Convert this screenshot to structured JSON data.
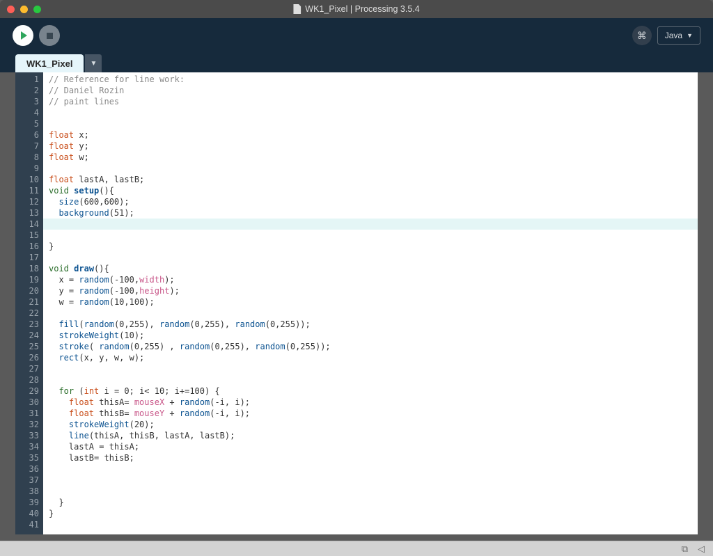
{
  "window": {
    "title": "WK1_Pixel | Processing 3.5.4"
  },
  "toolbar": {
    "mode": "Java"
  },
  "tabs": {
    "active": "WK1_Pixel"
  },
  "editor": {
    "line_count": 41,
    "highlighted_line": 14,
    "lines": [
      [
        [
          "comment",
          "// Reference for line work:"
        ]
      ],
      [
        [
          "comment",
          "// Daniel Rozin"
        ]
      ],
      [
        [
          "comment",
          "// paint lines"
        ]
      ],
      [],
      [],
      [
        [
          "type",
          "float"
        ],
        [
          "default",
          " x;"
        ]
      ],
      [
        [
          "type",
          "float"
        ],
        [
          "default",
          " y;"
        ]
      ],
      [
        [
          "type",
          "float"
        ],
        [
          "default",
          " w;"
        ]
      ],
      [],
      [
        [
          "type",
          "float"
        ],
        [
          "default",
          " lastA, lastB;"
        ]
      ],
      [
        [
          "keyword",
          "void"
        ],
        [
          "default",
          " "
        ],
        [
          "funcname",
          "setup"
        ],
        [
          "default",
          "(){"
        ]
      ],
      [
        [
          "default",
          "  "
        ],
        [
          "builtin",
          "size"
        ],
        [
          "default",
          "(600,600);"
        ]
      ],
      [
        [
          "default",
          "  "
        ],
        [
          "builtin",
          "background"
        ],
        [
          "default",
          "(51);"
        ]
      ],
      [],
      [],
      [
        [
          "default",
          "}"
        ]
      ],
      [],
      [
        [
          "keyword",
          "void"
        ],
        [
          "default",
          " "
        ],
        [
          "funcname",
          "draw"
        ],
        [
          "default",
          "(){"
        ]
      ],
      [
        [
          "default",
          "  x = "
        ],
        [
          "builtin",
          "random"
        ],
        [
          "default",
          "(-100,"
        ],
        [
          "special",
          "width"
        ],
        [
          "default",
          ");"
        ]
      ],
      [
        [
          "default",
          "  y = "
        ],
        [
          "builtin",
          "random"
        ],
        [
          "default",
          "(-100,"
        ],
        [
          "special",
          "height"
        ],
        [
          "default",
          ");"
        ]
      ],
      [
        [
          "default",
          "  w = "
        ],
        [
          "builtin",
          "random"
        ],
        [
          "default",
          "(10,100);"
        ]
      ],
      [],
      [
        [
          "default",
          "  "
        ],
        [
          "builtin",
          "fill"
        ],
        [
          "default",
          "("
        ],
        [
          "builtin",
          "random"
        ],
        [
          "default",
          "(0,255), "
        ],
        [
          "builtin",
          "random"
        ],
        [
          "default",
          "(0,255), "
        ],
        [
          "builtin",
          "random"
        ],
        [
          "default",
          "(0,255));"
        ]
      ],
      [
        [
          "default",
          "  "
        ],
        [
          "builtin",
          "strokeWeight"
        ],
        [
          "default",
          "(10);"
        ]
      ],
      [
        [
          "default",
          "  "
        ],
        [
          "builtin",
          "stroke"
        ],
        [
          "default",
          "( "
        ],
        [
          "builtin",
          "random"
        ],
        [
          "default",
          "(0,255) , "
        ],
        [
          "builtin",
          "random"
        ],
        [
          "default",
          "(0,255), "
        ],
        [
          "builtin",
          "random"
        ],
        [
          "default",
          "(0,255));"
        ]
      ],
      [
        [
          "default",
          "  "
        ],
        [
          "builtin",
          "rect"
        ],
        [
          "default",
          "(x, y, w, w);"
        ]
      ],
      [],
      [],
      [
        [
          "default",
          "  "
        ],
        [
          "keyword",
          "for"
        ],
        [
          "default",
          " ("
        ],
        [
          "type",
          "int"
        ],
        [
          "default",
          " i = 0; i< 10; i+=100) {"
        ]
      ],
      [
        [
          "default",
          "    "
        ],
        [
          "type",
          "float"
        ],
        [
          "default",
          " thisA= "
        ],
        [
          "special",
          "mouseX"
        ],
        [
          "default",
          " + "
        ],
        [
          "builtin",
          "random"
        ],
        [
          "default",
          "(-i, i);"
        ]
      ],
      [
        [
          "default",
          "    "
        ],
        [
          "type",
          "float"
        ],
        [
          "default",
          " thisB= "
        ],
        [
          "special",
          "mouseY"
        ],
        [
          "default",
          " + "
        ],
        [
          "builtin",
          "random"
        ],
        [
          "default",
          "(-i, i);"
        ]
      ],
      [
        [
          "default",
          "    "
        ],
        [
          "builtin",
          "strokeWeight"
        ],
        [
          "default",
          "(20);"
        ]
      ],
      [
        [
          "default",
          "    "
        ],
        [
          "builtin",
          "line"
        ],
        [
          "default",
          "(thisA, thisB, lastA, lastB);"
        ]
      ],
      [
        [
          "default",
          "    lastA = thisA;"
        ]
      ],
      [
        [
          "default",
          "    lastB= thisB;"
        ]
      ],
      [],
      [],
      [],
      [
        [
          "default",
          "  }"
        ]
      ],
      [
        [
          "default",
          "}"
        ]
      ],
      []
    ]
  }
}
